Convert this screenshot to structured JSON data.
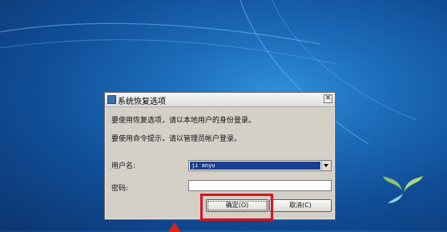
{
  "dialog": {
    "title": "系统恢复选项",
    "close_label": "✕",
    "line1": "要使用恢复选项，请以本地用户的身份登录。",
    "line2": "要使用命令提示，请以管理员帐户登录。",
    "username_label": "用户名:",
    "username_value": "ji anyu",
    "password_label": "密码:",
    "password_value": "",
    "ok_label": "确定(O)",
    "cancel_label": "取消(C)"
  },
  "colors": {
    "highlight": "#d8141d",
    "selection": "#1b3d8f",
    "desktop": "#1c6bb8"
  },
  "icons": {
    "title_icon": "recovery-icon",
    "close": "close-icon",
    "dropdown": "chevron-down-icon",
    "desktop_logo": "windows-logo-icon",
    "arrow": "arrow-up-icon"
  }
}
